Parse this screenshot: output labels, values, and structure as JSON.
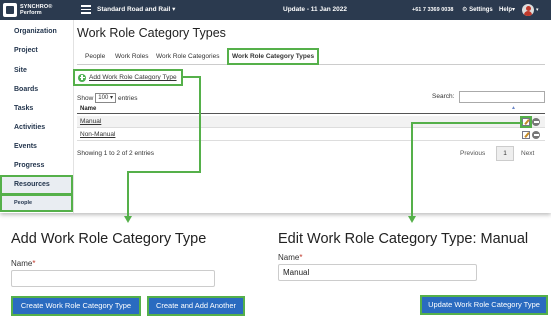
{
  "topbar": {
    "logo_line1": "SYNCHRO",
    "logo_line1_sup": "®",
    "logo_line2": "Perform",
    "project": "Standard Road and Rail",
    "project_caret": "▾",
    "update": "Update - 11 Jan 2022",
    "phone": "+61 7 3369 0038",
    "settings": "Settings",
    "help": "Help",
    "caret": "▾"
  },
  "sidebar": {
    "items": [
      {
        "label": "Organization"
      },
      {
        "label": "Project"
      },
      {
        "label": "Site"
      },
      {
        "label": "Boards"
      },
      {
        "label": "Tasks"
      },
      {
        "label": "Activities"
      },
      {
        "label": "Events"
      },
      {
        "label": "Progress"
      },
      {
        "label": "Resources"
      },
      {
        "label": "People"
      }
    ]
  },
  "main": {
    "title": "Work Role Category Types",
    "tabs": [
      {
        "label": "People"
      },
      {
        "label": "Work Roles"
      },
      {
        "label": "Work Role Categories"
      },
      {
        "label": "Work Role Category Types"
      }
    ],
    "add_link": "Add Work Role Category Type",
    "show_label": "Show",
    "entries_count": "100",
    "entries_caret": "▾",
    "entries_label": "entries",
    "search_label": "Search:",
    "column_name": "Name",
    "sort_icon": "▲",
    "rows": [
      {
        "name": "Manual"
      },
      {
        "name": "Non-Manual"
      }
    ],
    "showing": "Showing 1 to 2 of 2 entries",
    "previous": "Previous",
    "page": "1",
    "next": "Next"
  },
  "add_panel": {
    "title": "Add Work Role Category Type",
    "name_label": "Name",
    "required_mark": "*",
    "name_value": "",
    "create_button": "Create Work Role Category Type",
    "create_another_button": "Create and Add Another"
  },
  "edit_panel": {
    "title": "Edit Work Role Category Type: Manual",
    "name_label": "Name",
    "required_mark": "*",
    "name_value": "Manual",
    "update_button": "Update Work Role Category Type"
  },
  "colors": {
    "topbar": "#2b3a4f",
    "highlight": "#55b04a",
    "button": "#2a6bc0"
  }
}
